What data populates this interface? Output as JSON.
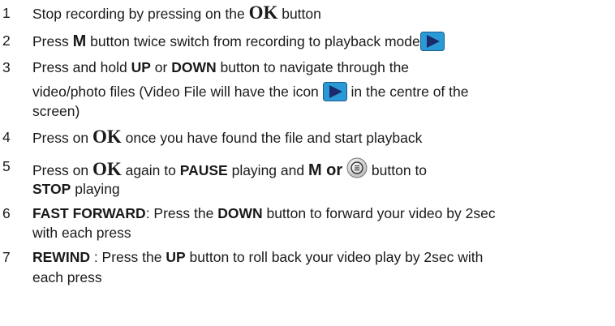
{
  "steps": [
    {
      "num": "1",
      "parts": {
        "a": "Stop recording by pressing on the ",
        "ok": "OK",
        "b": " button"
      }
    },
    {
      "num": "2",
      "parts": {
        "a": "Press ",
        "m": "M",
        "b": " button twice switch from recording to playback mode"
      }
    },
    {
      "num": "3",
      "parts": {
        "a": "Press and hold ",
        "up": "UP",
        "or": " or ",
        "down": "DOWN",
        "b": " button to navigate through the",
        "c": "video/photo files (Video File will have the icon ",
        "d": " in the centre of the",
        "e": "screen)"
      }
    },
    {
      "num": "4",
      "parts": {
        "a": "Press on ",
        "ok": "OK",
        "b": " once you have found the file and start playback"
      }
    },
    {
      "num": "5",
      "parts": {
        "a": "Press on ",
        "ok": "OK",
        "b": " again to ",
        "pause": "PAUSE",
        "c": " playing and ",
        "m_or": "M or",
        "d": " button to",
        "stop": "STOP",
        "e": " playing"
      }
    },
    {
      "num": "6",
      "parts": {
        "ff": "FAST FORWARD",
        "a": ": Press the ",
        "down": "DOWN",
        "b": " button to forward your video by 2sec",
        "c": "with each press"
      }
    },
    {
      "num": "7",
      "parts": {
        "rw": "REWIND",
        "a": " : Press the ",
        "up": "UP",
        "b": " button to roll back your video play by 2sec with",
        "c": "each press"
      }
    }
  ],
  "icons": {
    "play": "play-icon",
    "menu": "menu-button-icon",
    "play_color": "#2a9ad6",
    "play_arrow_color": "#1a2a6a"
  }
}
